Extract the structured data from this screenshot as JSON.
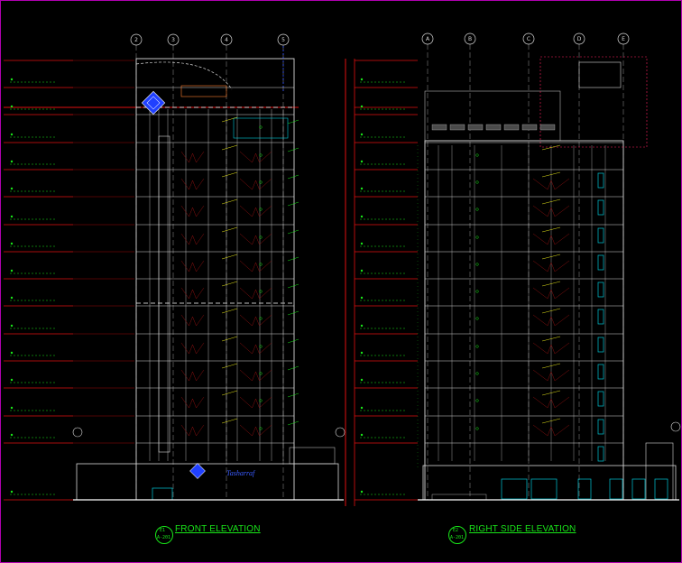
{
  "colors": {
    "background": "#000000",
    "border": "#b000b0",
    "level_line": "#e01010",
    "building_line": "#d8d8d8",
    "grid_line": "#9a9a9a",
    "annotation": "#19e619",
    "leader": "#e6e619",
    "glazing": "#00c8d8",
    "logo": "#2040ff",
    "callout": "#ff2060"
  },
  "views": [
    {
      "id": "front",
      "title": "FRONT ELEVATION",
      "ref_number": "E1",
      "ref_sheet": "A-201",
      "grid_labels": [
        "2",
        "3",
        "4",
        "5"
      ]
    },
    {
      "id": "side",
      "title": "RIGHT SIDE ELEVATION",
      "ref_number": "E2",
      "ref_sheet": "A-201",
      "grid_labels": [
        "A",
        "B",
        "C",
        "D",
        "E"
      ]
    }
  ],
  "logo_text": "Tasharraf",
  "floor_count": 14,
  "icons": {
    "logo": "diamond-logo-icon",
    "grid_bubble": "grid-bubble-icon"
  }
}
